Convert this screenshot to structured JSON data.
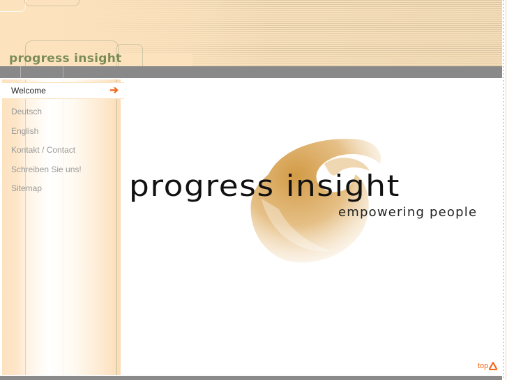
{
  "header": {
    "brand": "progress insight"
  },
  "sidebar": {
    "items": [
      {
        "label": "Welcome",
        "active": true,
        "icon": "arrow-right-icon",
        "arrow": "➔"
      },
      {
        "label": "Deutsch"
      },
      {
        "label": "English"
      },
      {
        "label": "Kontakt / Contact"
      },
      {
        "label": "Schreiben Sie uns!"
      },
      {
        "label": "Sitemap"
      }
    ]
  },
  "main": {
    "logo_title": "progress insight",
    "logo_tagline": "empowering people"
  },
  "top_link": {
    "label": "top",
    "icon": "arrow-up-icon"
  },
  "colors": {
    "accent": "#f26b1d",
    "brand_green": "#7b8c56",
    "header_bg": "#fde3bd",
    "bar_gray": "#898989",
    "swirl_gold": "#d9a95a"
  }
}
